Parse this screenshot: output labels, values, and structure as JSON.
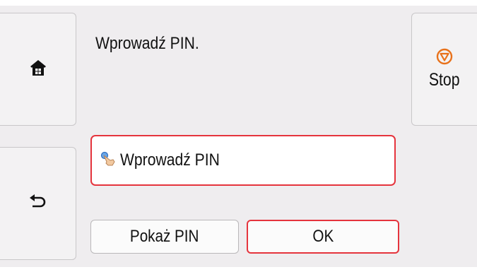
{
  "message": "Wprowadź PIN.",
  "pin_field": {
    "label": "Wprowadź PIN"
  },
  "buttons": {
    "show_pin": "Pokaż PIN",
    "ok": "OK",
    "stop": "Stop"
  },
  "icons": {
    "home": "home-icon",
    "back": "back-icon",
    "stop": "stop-icon",
    "touch": "tap-hand-icon"
  },
  "colors": {
    "accent_red": "#e5343d",
    "stop_orange": "#e8711a",
    "background": "#efedef"
  }
}
